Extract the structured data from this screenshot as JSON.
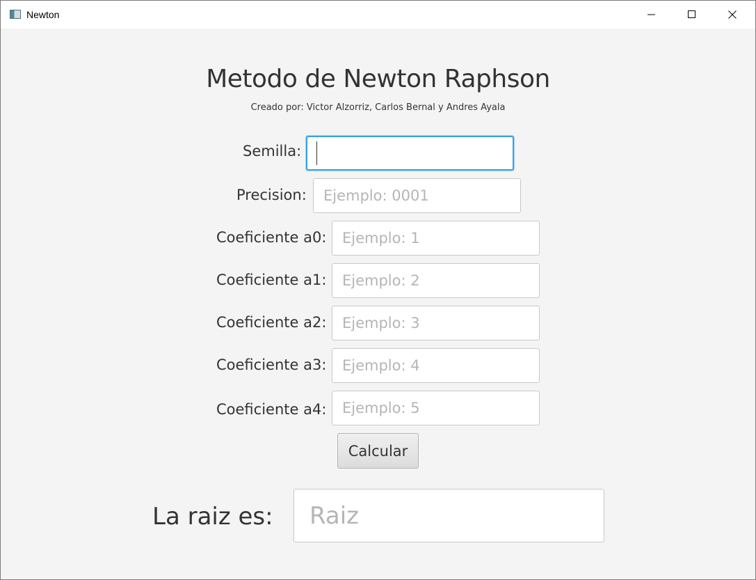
{
  "window": {
    "title": "Newton",
    "controls": {
      "minimize": "minimize-icon",
      "maximize": "maximize-icon",
      "close": "close-icon"
    }
  },
  "header": {
    "title": "Metodo de Newton Raphson",
    "subtitle": "Creado por: Victor Alzorriz, Carlos Bernal y Andres Ayala"
  },
  "form": {
    "semilla": {
      "label": "Semilla:",
      "placeholder": "",
      "value": ""
    },
    "precision": {
      "label": "Precision:",
      "placeholder": "Ejemplo: 0001",
      "value": ""
    },
    "a0": {
      "label": "Coeficiente a0:",
      "placeholder": "Ejemplo: 1",
      "value": ""
    },
    "a1": {
      "label": "Coeficiente a1:",
      "placeholder": "Ejemplo: 2",
      "value": ""
    },
    "a2": {
      "label": "Coeficiente a2:",
      "placeholder": "Ejemplo: 3",
      "value": ""
    },
    "a3": {
      "label": "Coeficiente a3:",
      "placeholder": "Ejemplo: 4",
      "value": ""
    },
    "a4": {
      "label": "Coeficiente a4:",
      "placeholder": "Ejemplo: 5",
      "value": ""
    },
    "submit_label": "Calcular"
  },
  "result": {
    "label": "La raiz es:",
    "placeholder": "Raiz",
    "value": ""
  },
  "colors": {
    "background": "#f4f4f4",
    "focus_border": "#3ca0e0",
    "text": "#333333",
    "placeholder": "#b5b5b5"
  }
}
